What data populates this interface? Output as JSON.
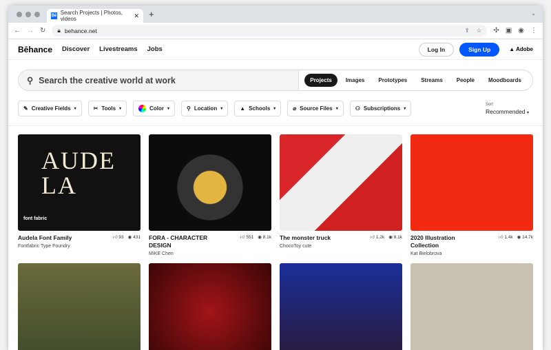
{
  "browser": {
    "tab_title": "Search Projects | Photos, videos",
    "favicon": "Bē",
    "url": "behance.net"
  },
  "header": {
    "logo": "Bēhance",
    "nav": [
      "Discover",
      "Livestreams",
      "Jobs"
    ],
    "login": "Log In",
    "signup": "Sign Up",
    "adobe": "Adobe"
  },
  "search": {
    "placeholder": "Search the creative world at work",
    "tabs": [
      "Projects",
      "Images",
      "Prototypes",
      "Streams",
      "People",
      "Moodboards"
    ]
  },
  "filters": [
    "Creative Fields",
    "Tools",
    "Color",
    "Location",
    "Schools",
    "Source Files",
    "Subscriptions"
  ],
  "sort": {
    "label": "Sort",
    "value": "Recommended"
  },
  "cards": [
    {
      "title": "Audela Font Family",
      "owner": "Fontfabric Type Foundry",
      "likes": "93",
      "views": "431",
      "art": "AUDELA",
      "art2": "font fabric"
    },
    {
      "title": "FORA - CHARACTER DESIGN",
      "owner": "MIKE Chen",
      "likes": "551",
      "views": "8.1k"
    },
    {
      "title": "The monster truck",
      "owner": "ChocoToy cute",
      "likes": "1.2k",
      "views": "8.1k"
    },
    {
      "title": "2020 Illustration Collection",
      "owner": "Kat Bielobrova",
      "likes": "1.4k",
      "views": "14.7k"
    }
  ]
}
